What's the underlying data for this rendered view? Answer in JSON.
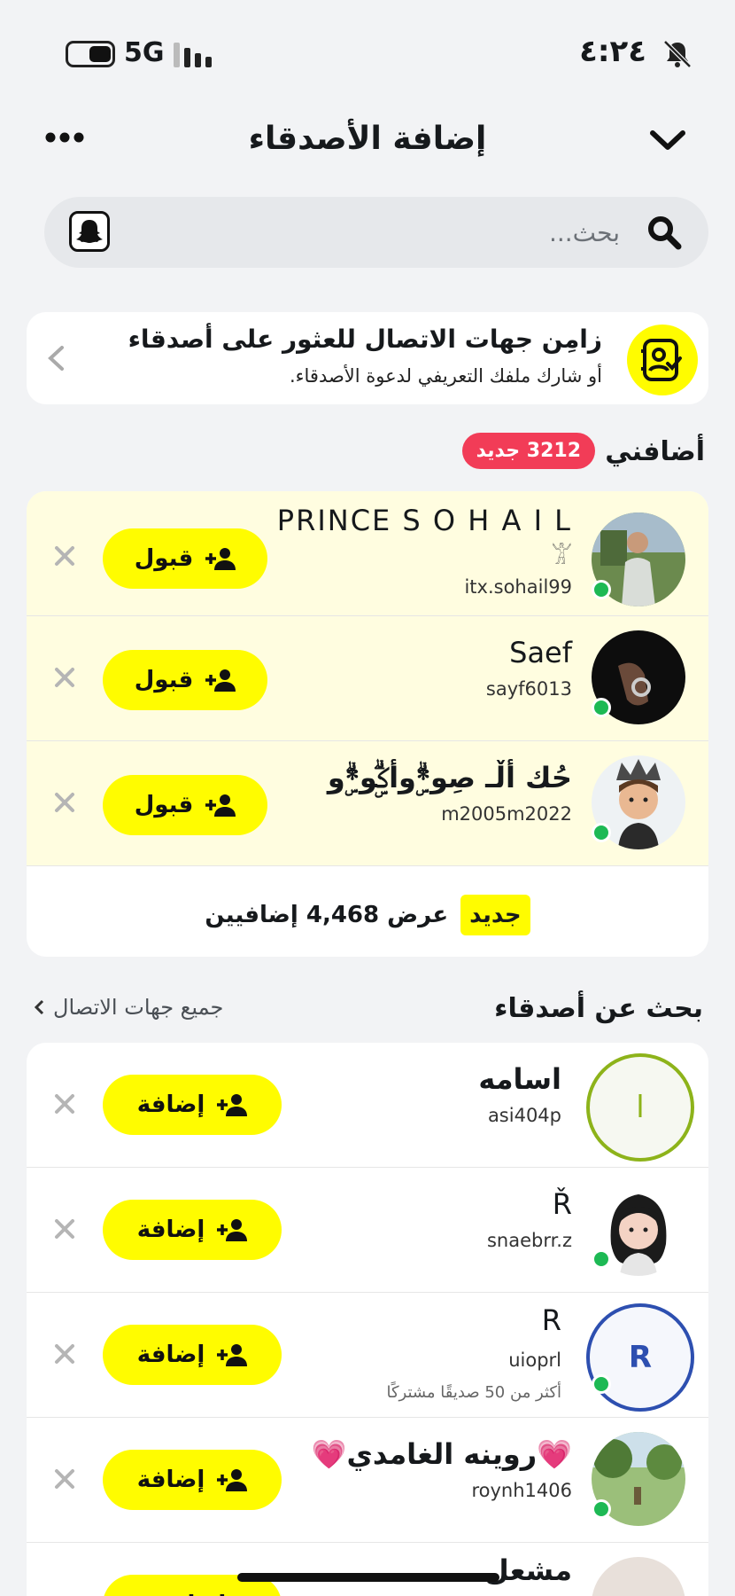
{
  "status": {
    "time": "٤:٢٤",
    "network": "5G"
  },
  "header": {
    "title": "إضافة الأصدقاء"
  },
  "search": {
    "placeholder": "بحث..."
  },
  "sync": {
    "title": "زامِن جهات الاتصال للعثور على أصدقاء",
    "subtitle": "أو شارك ملفك التعريفي لدعوة الأصدقاء."
  },
  "added_me": {
    "title": "أضافني",
    "new_badge": "3212 جديد",
    "accept_label": "قبول",
    "items": [
      {
        "name": "PRINCE S O H A I L",
        "symbol": "𓀠",
        "username": "itx.sohail99"
      },
      {
        "name": "Saef",
        "username": "sayf6013"
      },
      {
        "name": "حُك أڵـ صِو*ۣۗوأكۣۗو*ۣۗو",
        "username": "m2005m2022"
      }
    ],
    "view_more_new": "جديد",
    "view_more_label": "عرض 4,468 إضافيين"
  },
  "find_friends": {
    "title": "بحث عن أصدقاء",
    "all_contacts": "جميع جهات الاتصال",
    "add_label": "إضافة",
    "items": [
      {
        "name": "اسامه",
        "username": "asi404p",
        "initial": "ا"
      },
      {
        "name": "Ř",
        "username": "snaebrr.z"
      },
      {
        "name": "R",
        "username": "uioprl",
        "initial": "R",
        "mutual": "أكثر من 50 صديقًا مشتركًا"
      },
      {
        "name": "💗روينه الغامدي💗",
        "username": "roynh1406"
      },
      {
        "name": "مشعل",
        "username": ""
      }
    ]
  },
  "colors": {
    "accent": "#fffc00",
    "badge": "#f23c57",
    "online": "#1db954"
  }
}
